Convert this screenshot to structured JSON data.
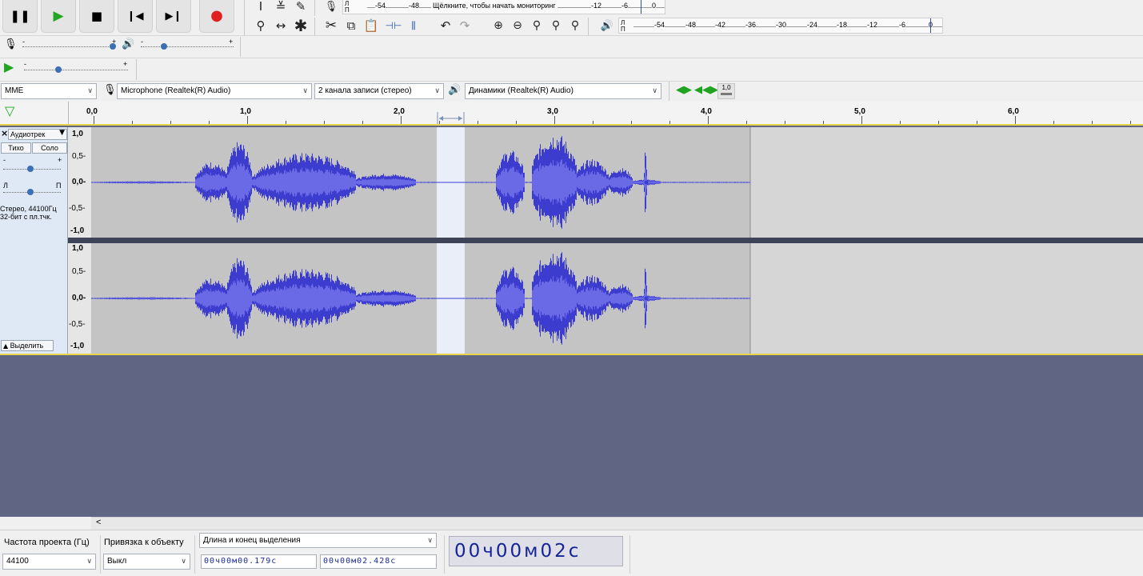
{
  "transport": {
    "pause_icon": "pause-icon",
    "play_icon": "play-icon",
    "stop_icon": "stop-icon",
    "skip_start_icon": "skip-to-start-icon",
    "skip_end_icon": "skip-to-end-icon",
    "record_icon": "record-icon",
    "record_color": "#e02020",
    "play_color": "#21a621"
  },
  "record_meter": {
    "ticks": [
      "-54",
      "-48",
      "-12",
      "-6",
      "0"
    ],
    "hint": "Щёлкните, чтобы начать мониторинг",
    "channel_top": "Л",
    "channel_bottom": "П"
  },
  "playback_meter": {
    "ticks": [
      "-54",
      "-48",
      "-42",
      "-36",
      "-30",
      "-24",
      "-18",
      "-12",
      "-6",
      "0"
    ],
    "channel_top": "Л",
    "channel_bottom": "П"
  },
  "mixer": {
    "minus": "-",
    "plus": "+"
  },
  "device": {
    "host": "MME",
    "input_device": "Microphone (Realtek(R) Audio)",
    "channels": "2 канала записи (стерео)",
    "output_device": "Динамики (Realtek(R) Audio)",
    "speed_label": "1,0"
  },
  "ruler": {
    "labels": [
      "0,0",
      "1,0",
      "2,0",
      "3,0",
      "4,0",
      "5,0",
      "6,0"
    ]
  },
  "track": {
    "close": "×",
    "name": "Аудиотрек",
    "name_arrow": "▼",
    "mute": "Тихо",
    "solo": "Соло",
    "gain_minus": "-",
    "gain_plus": "+",
    "pan_left": "Л",
    "pan_right": "П",
    "info_line1": "Стерео, 44100Гц",
    "info_line2": "32-бит с пл.тчк.",
    "collapse_arrow": "▲",
    "select_label": "Выделить",
    "scale": [
      "1,0",
      "0,5-",
      "0,0-",
      "-0,5-",
      "-1,0"
    ],
    "waveform_color": "#3c3ccf",
    "waveform_rms_color": "#6a6ae6"
  },
  "scroll": {
    "left_arrow": "<"
  },
  "status": {
    "rate_label": "Частота проекта (Гц)",
    "snap_label": "Привязка к объекту",
    "selection_mode": "Длина и конец выделения",
    "rate_value": "44100",
    "snap_value": "Выкл",
    "sel_length": "00ч00м00.179с",
    "sel_end": "00ч00м02.428с",
    "audio_position": "00ч00м02с"
  }
}
